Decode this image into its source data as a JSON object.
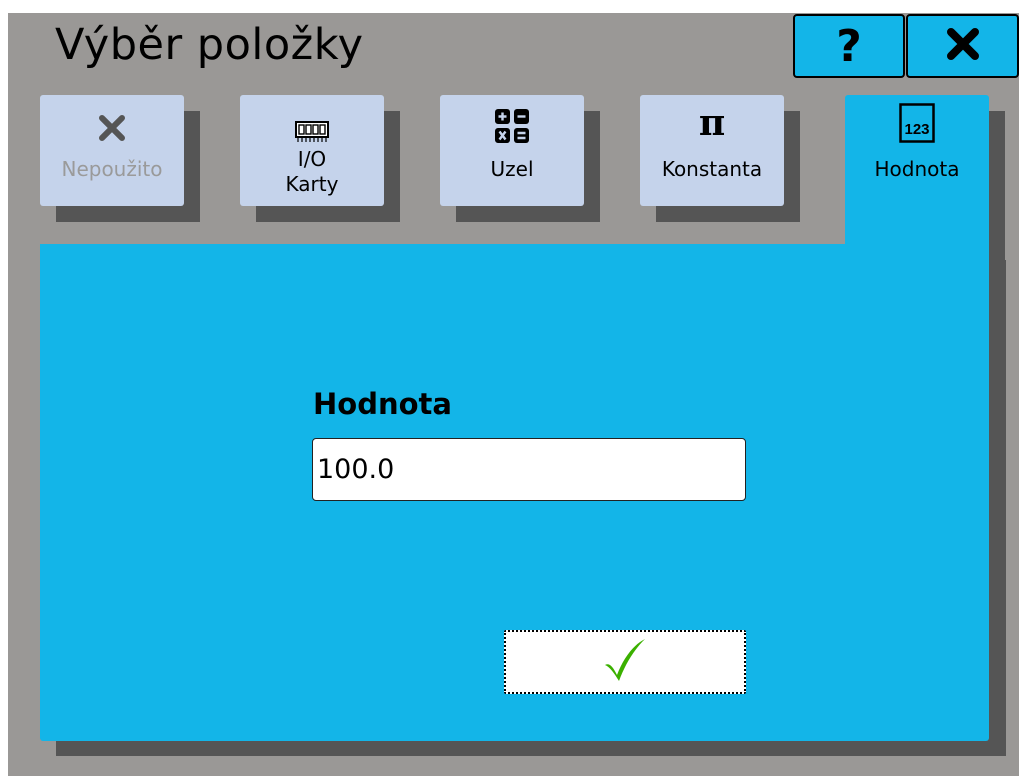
{
  "window": {
    "title": "Výběr položky"
  },
  "header_buttons": {
    "help": {
      "label": "?",
      "icon": "question-mark-icon"
    },
    "close": {
      "label": "✖",
      "icon": "close-icon"
    }
  },
  "tabs": [
    {
      "id": "unused",
      "label": "Nepoužito",
      "icon": "x-icon",
      "state": "disabled"
    },
    {
      "id": "io",
      "label": "I/O\nKarty",
      "icon": "memory-card-icon",
      "state": "normal"
    },
    {
      "id": "node",
      "label": "Uzel",
      "icon": "calculator-icon",
      "state": "normal"
    },
    {
      "id": "constant",
      "label": "Konstanta",
      "icon": "pi-icon",
      "state": "normal"
    },
    {
      "id": "value",
      "label": "Hodnota",
      "icon": "numeric-123-icon",
      "state": "active"
    }
  ],
  "form": {
    "label": "Hodnota",
    "value": "100.0"
  },
  "confirm_button": {
    "icon": "checkmark-icon"
  },
  "colors": {
    "accent": "#13b5e8",
    "frame_bg": "#9a9896",
    "tab_bg": "#c5d3eb",
    "shadow": "#555555",
    "check_green": "#3bb000"
  }
}
